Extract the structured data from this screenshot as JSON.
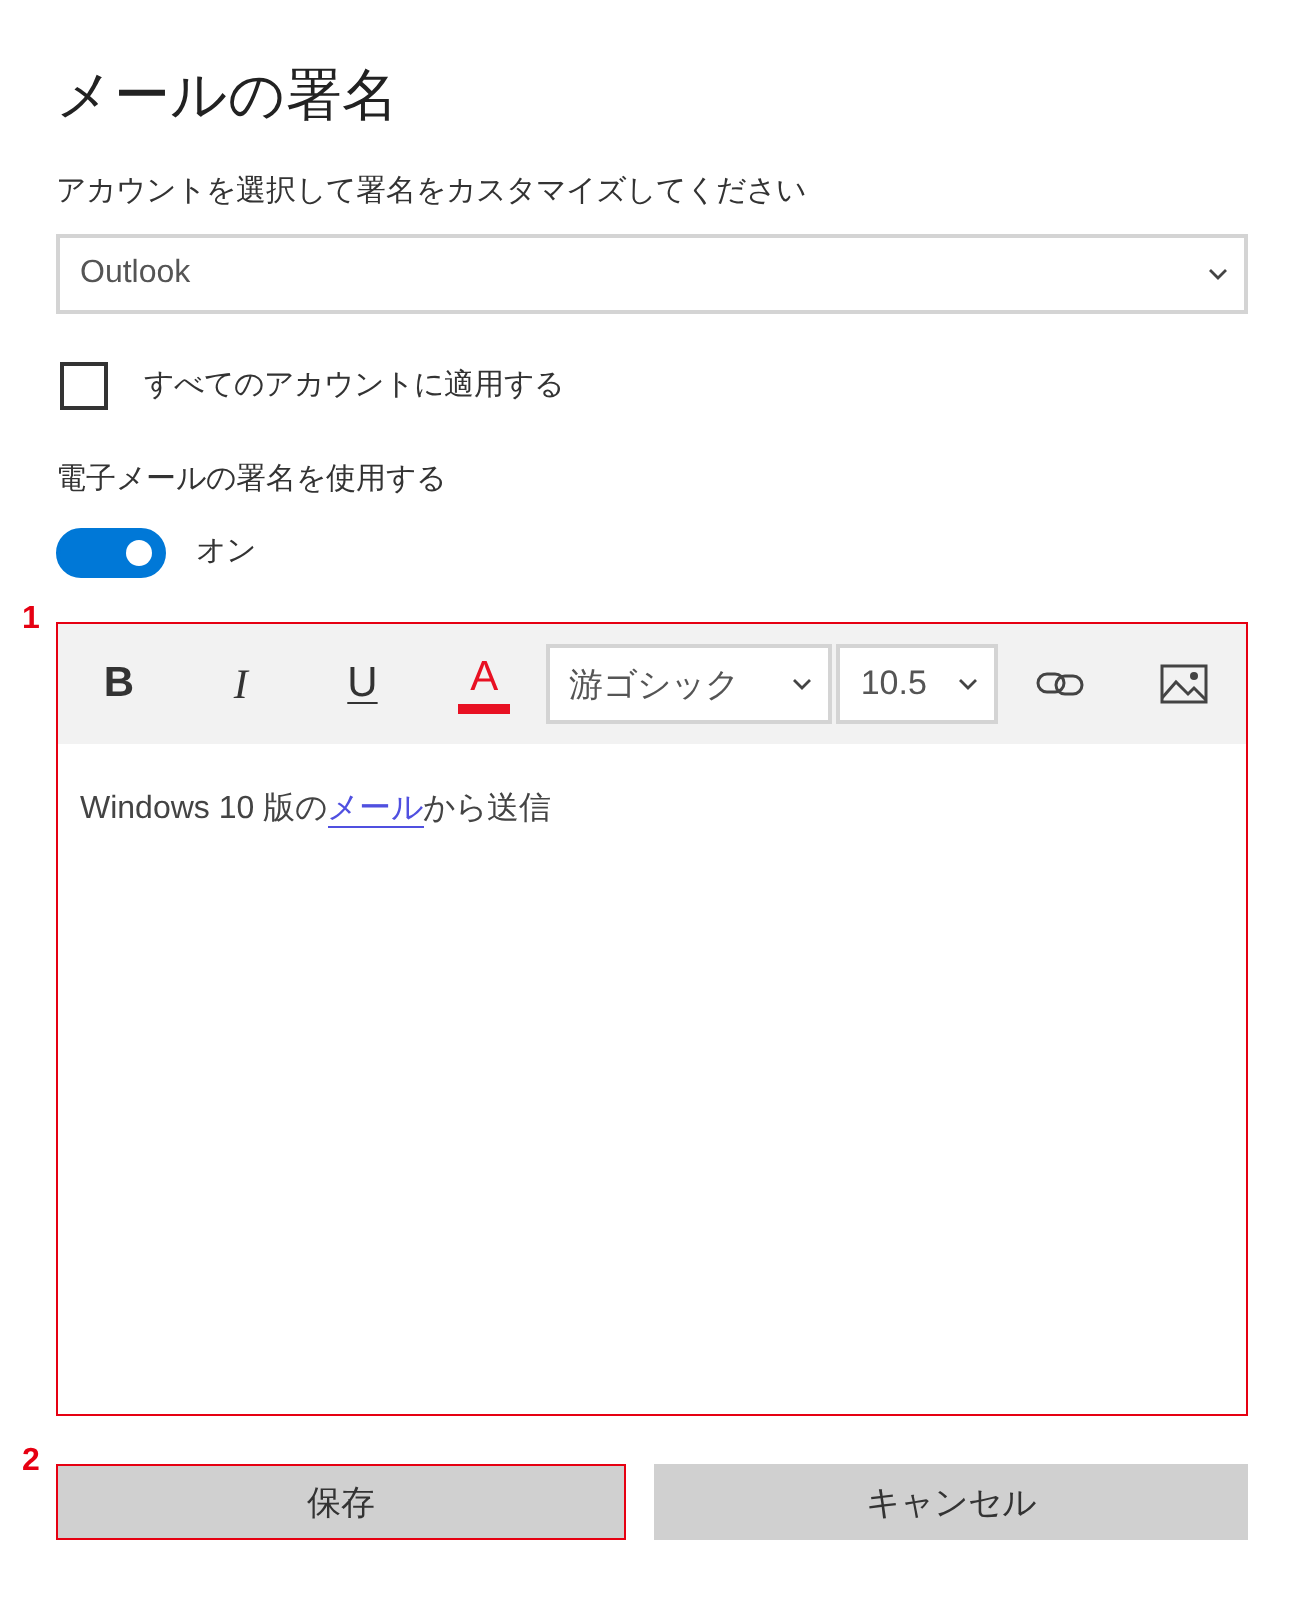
{
  "title": "メールの署名",
  "account": {
    "label": "アカウントを選択して署名をカスタマイズしてください",
    "value": "Outlook"
  },
  "apply_all": {
    "label": "すべてのアカウントに適用する",
    "checked": false
  },
  "use_signature": {
    "label": "電子メールの署名を使用する",
    "on": true,
    "state_text": "オン"
  },
  "editor": {
    "callout": "1",
    "highlighted": true,
    "format_buttons": [
      {
        "label": "B",
        "kind": "bold"
      },
      {
        "label": "I",
        "kind": "italic"
      },
      {
        "label": "U",
        "kind": "underline"
      },
      {
        "label": "A",
        "kind": "font_color",
        "color": "#e81123"
      }
    ],
    "font": "游ゴシック",
    "size": "10.5",
    "body": [
      {
        "kind": "text",
        "text": "Windows 10 版の"
      },
      {
        "kind": "link",
        "text": "メール"
      },
      {
        "kind": "text",
        "text": "から送信"
      }
    ]
  },
  "buttons": [
    {
      "label": "保存",
      "callout": "2",
      "highlighted": true
    },
    {
      "label": "キャンセル",
      "highlighted": false
    }
  ]
}
